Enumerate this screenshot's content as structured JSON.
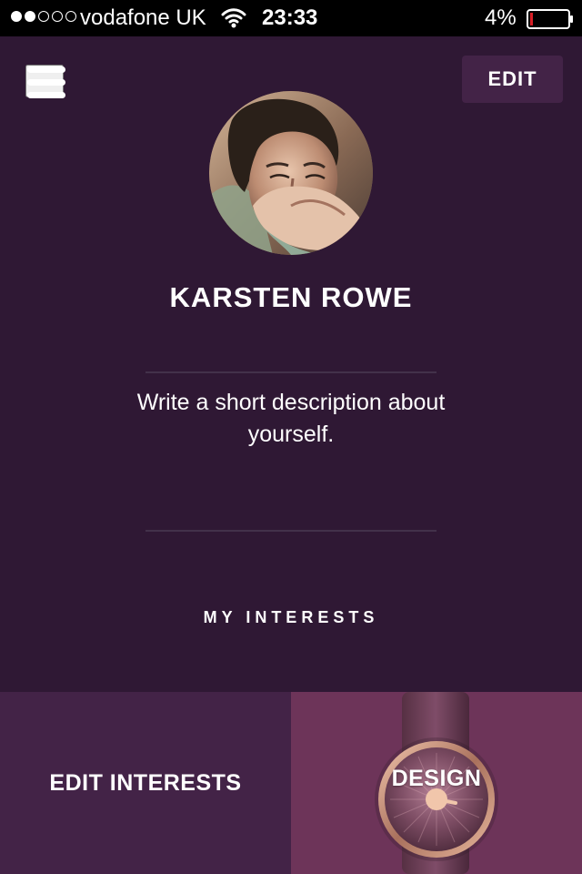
{
  "status_bar": {
    "carrier": "vodafone UK",
    "time": "23:33",
    "battery_percent": "4%",
    "signal_strength_dots_filled": 2,
    "signal_strength_dots_total": 5,
    "battery_level": 0.04,
    "battery_color": "#d81f26",
    "wifi_icon": "wifi-icon",
    "battery_icon": "battery-icon"
  },
  "header": {
    "menu_icon": "hamburger-menu-icon",
    "edit_label": "EDIT"
  },
  "profile": {
    "name": "KARSTEN ROWE",
    "description": "Write a short description about yourself.",
    "avatar": "profile-photo"
  },
  "interests": {
    "heading": "MY INTERESTS",
    "edit_label": "EDIT INTERESTS",
    "items": [
      {
        "label": "DESIGN",
        "image": "watch-design-image"
      }
    ]
  },
  "colors": {
    "background": "#2f1834",
    "button_background": "#432347",
    "design_tile": "#6a3357",
    "divider": "#43314a",
    "text": "#ffffff"
  }
}
